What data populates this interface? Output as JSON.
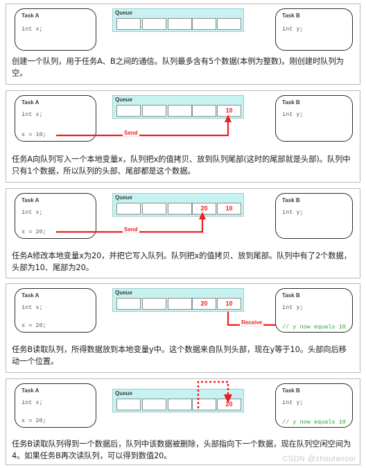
{
  "meta": {
    "watermark": "CSDN @zhoutanooi"
  },
  "labels": {
    "queue_title": "Queue",
    "task_a_title": "Task A",
    "task_b_title": "Task B",
    "send": "Send",
    "receive": "Receive",
    "decl_x": "int x;",
    "decl_y": "int y;",
    "assign_x10": "x = 10;",
    "assign_x20": "x = 20;",
    "comment_y10": "// y now equals 10"
  },
  "colors": {
    "queue_fill": "#c6f2f2",
    "queue_border": "#9fcccc",
    "slot_border": "#8c8c8c",
    "value_red": "#ee1c1c",
    "arrow_red": "#ee1c1c",
    "comment_green": "#28a428",
    "code_gray": "#555555",
    "panel_border": "#b9b9b9",
    "task_border": "#2b2b2b"
  },
  "queue_capacity": 5,
  "panels": [
    {
      "id": "panel-1",
      "task_a": {
        "title": "Task A",
        "lines": [
          "int x;"
        ]
      },
      "task_b": {
        "title": "Task B",
        "lines": [
          "int y;"
        ]
      },
      "queue": {
        "label": "Queue",
        "slots": [
          "",
          "",
          "",
          "",
          ""
        ]
      },
      "arrow": {
        "type": "none",
        "label": ""
      },
      "caption": "创建一个队列，用于任务A、B之间的通信。队列最多含有5个数据(本例为整数)。刚创建时队列为空。"
    },
    {
      "id": "panel-2",
      "task_a": {
        "title": "Task A",
        "lines": [
          "int x;",
          "x = 10;"
        ]
      },
      "task_b": {
        "title": "Task B",
        "lines": [
          "int y;"
        ]
      },
      "queue": {
        "label": "Queue",
        "slots": [
          "",
          "",
          "",
          "",
          "10"
        ]
      },
      "arrow": {
        "type": "send",
        "label": "Send"
      },
      "caption": "任务A向队列写入一个本地变量x，队列把x的值拷贝、放到队列尾部(这时的尾部就是头部)。队列中只有1个数据，所以队列的头部、尾部都是这个数据。"
    },
    {
      "id": "panel-3",
      "task_a": {
        "title": "Task A",
        "lines": [
          "int x;",
          "x = 20;"
        ]
      },
      "task_b": {
        "title": "Task B",
        "lines": [
          "int y;"
        ]
      },
      "queue": {
        "label": "Queue",
        "slots": [
          "",
          "",
          "",
          "20",
          "10"
        ]
      },
      "arrow": {
        "type": "send",
        "label": "Send"
      },
      "caption": "任务A修改本地变量x为20，并把它写入队列。队列把x的值拷贝、放到尾部。队列中有了2个数据，头部为10、尾部为20。"
    },
    {
      "id": "panel-4",
      "task_a": {
        "title": "Task A",
        "lines": [
          "int x;",
          "x = 20;"
        ]
      },
      "task_b": {
        "title": "Task B",
        "lines": [
          "int y;",
          "// y now equals 10"
        ]
      },
      "queue": {
        "label": "Queue",
        "slots": [
          "",
          "",
          "",
          "20",
          "10"
        ]
      },
      "arrow": {
        "type": "receive",
        "label": "Receive"
      },
      "caption": "任务B读取队列，所得数据放到本地变量y中。这个数据来自队列头部，现在y等于10。头部向后移动一个位置。"
    },
    {
      "id": "panel-5",
      "task_a": {
        "title": "Task A",
        "lines": [
          "int x;",
          "x = 20;"
        ]
      },
      "task_b": {
        "title": "Task B",
        "lines": [
          "int y;",
          "// y now equals 10"
        ]
      },
      "queue": {
        "label": "Queue",
        "slots": [
          "",
          "",
          "",
          "",
          "20"
        ]
      },
      "arrow": {
        "type": "shift",
        "label": ""
      },
      "caption": "任务B读取队列得到一个数据后，队列中该数据被删除，头部指向下一个数据，现在队列空闲空间为4。如果任务B再次读队列，可以得到数值20。"
    }
  ]
}
